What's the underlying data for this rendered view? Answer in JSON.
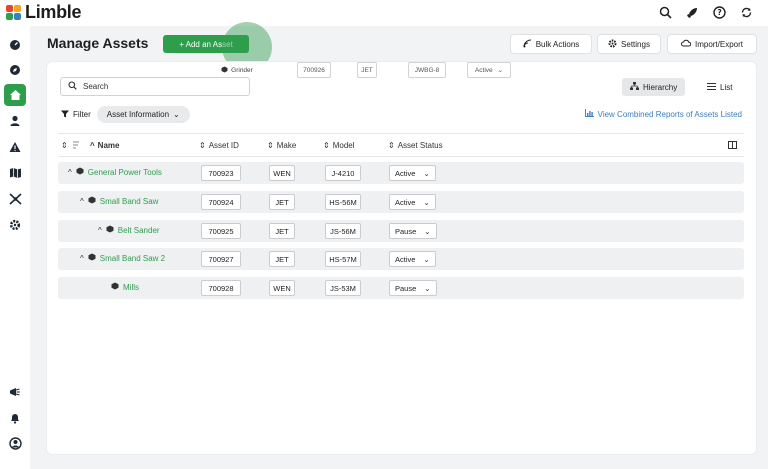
{
  "app": {
    "name": "Limble"
  },
  "header": {
    "title": "Manage Assets",
    "add_label": "+ Add an Asset",
    "bulk_label": "Bulk Actions",
    "settings_label": "Settings",
    "import_label": "Import/Export"
  },
  "search": {
    "placeholder": "Search"
  },
  "drag_row": {
    "name": "Grinder",
    "asset_id": "700926",
    "make": "JET",
    "model": "JWBG-8",
    "status": "Active"
  },
  "view": {
    "hierarchy_label": "Hierarchy",
    "list_label": "List"
  },
  "filter": {
    "label": "Filter",
    "chip_label": "Asset Information"
  },
  "reports_link": "View Combined Reports of Assets Listed",
  "columns": {
    "name": "Name",
    "asset_id": "Asset ID",
    "make": "Make",
    "model": "Model",
    "status": "Asset Status"
  },
  "rows": [
    {
      "name": "General Power Tools",
      "asset_id": "700923",
      "make": "WEN",
      "model": "J-4210",
      "status": "Active"
    },
    {
      "name": "Small Band Saw",
      "asset_id": "700924",
      "make": "JET",
      "model": "HS-56M",
      "status": "Active"
    },
    {
      "name": "Belt Sander",
      "asset_id": "700925",
      "make": "JET",
      "model": "JS-56M",
      "status": "Pause"
    },
    {
      "name": "Small Band Saw 2",
      "asset_id": "700927",
      "make": "JET",
      "model": "HS-57M",
      "status": "Active"
    },
    {
      "name": "Mills",
      "asset_id": "700928",
      "make": "WEN",
      "model": "JS-53M",
      "status": "Pause"
    }
  ],
  "colors": {
    "brand_green": "#2e9e4d",
    "link_blue": "#3a7fc1"
  }
}
